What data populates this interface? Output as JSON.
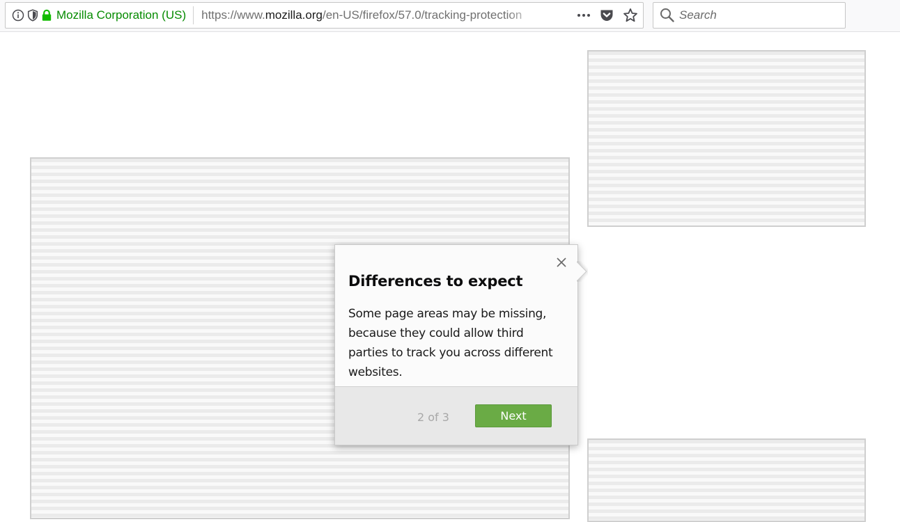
{
  "urlbar": {
    "identity_label": "Mozilla Corporation (US)",
    "url_prefix": "https://www.",
    "url_host": "mozilla.org",
    "url_path": "/en-US/firefox/57.0/tracking-protection",
    "more_label": "•••"
  },
  "search": {
    "placeholder": "Search"
  },
  "popup": {
    "title": "Differences to expect",
    "body": "Some page areas may be missing, because they could allow third parties to track you across different websites.",
    "step": "2 of 3",
    "next_label": "Next"
  },
  "colors": {
    "identity_green": "#058b00",
    "next_button": "#6aab45",
    "lock_green": "#12bc00"
  },
  "icons": {
    "info": "info-icon",
    "tracking": "shield-icon",
    "lock": "lock-icon",
    "more": "more-icon",
    "pocket": "pocket-icon",
    "bookmark": "star-icon",
    "search": "search-icon",
    "close": "close-icon"
  }
}
